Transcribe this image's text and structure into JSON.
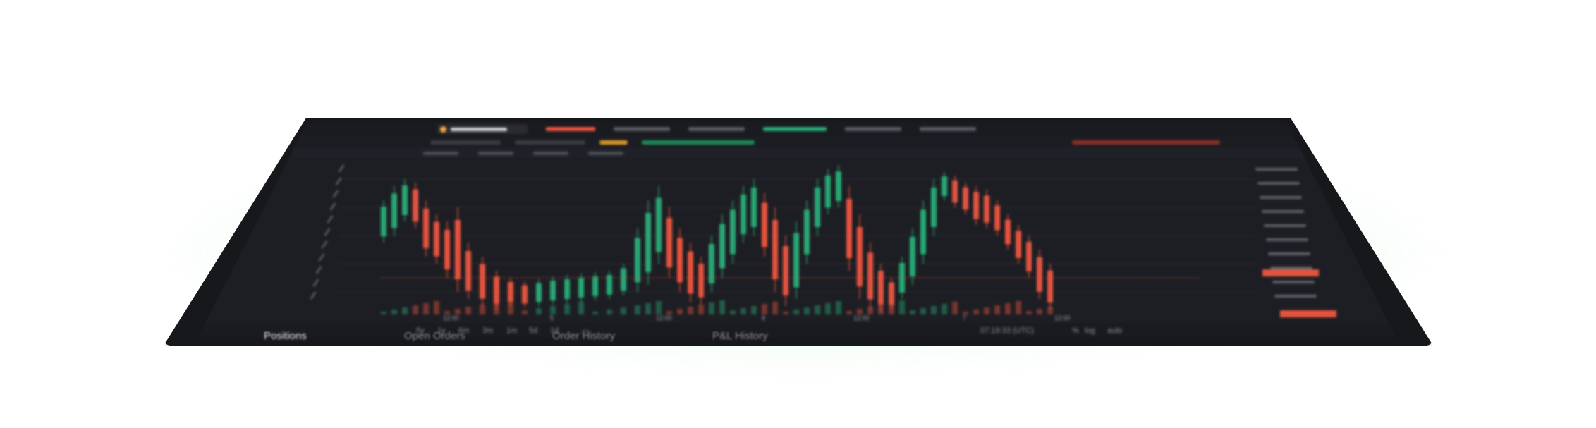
{
  "colors": {
    "background": "#ffffff",
    "device_frame": "#17181b",
    "screen_bg": "#1d1e23",
    "bull": "#27a874",
    "bear": "#e5533f",
    "glow": "#6ee68c"
  },
  "chart": {
    "legend": [
      {
        "id": "s1",
        "text": "",
        "tone": "normal"
      }
    ]
  },
  "time_axis": {
    "ticks": [
      "12:00",
      "5",
      "12:00",
      "6",
      "12:00",
      "7",
      "12:00"
    ]
  },
  "range_buttons": [
    "5y",
    "1y",
    "6m",
    "3m",
    "1m",
    "5d",
    "1d"
  ],
  "status": {
    "clock": "07:19:33 (UTC)",
    "log_label": "log",
    "auto_label": "auto"
  },
  "bottom_tabs": [
    {
      "label": "Positions",
      "active": true
    },
    {
      "label": "Open Orders",
      "active": false
    },
    {
      "label": "Order History",
      "active": false
    },
    {
      "label": "P&L History",
      "active": false
    }
  ],
  "icons": {
    "left_toolbar": [
      "crosshair-icon",
      "trendline-icon",
      "fib-icon",
      "brush-icon",
      "text-icon",
      "pattern-icon",
      "measure-icon",
      "zoom-icon",
      "magnet-icon",
      "lock-icon",
      "trash-icon"
    ],
    "brand": "tradingview-icon"
  }
}
